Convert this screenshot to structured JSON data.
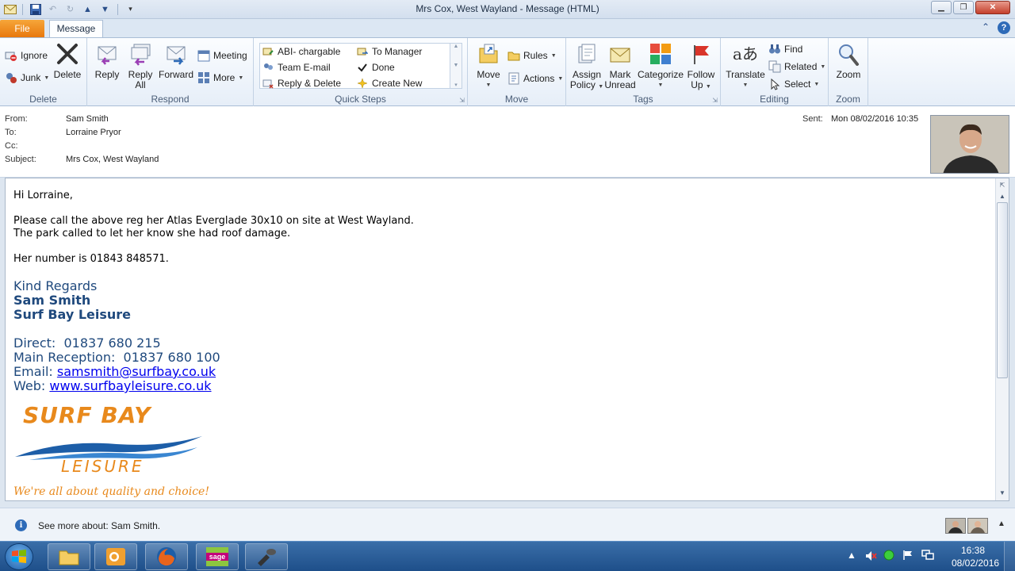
{
  "window": {
    "title": "Mrs Cox, West Wayland  -  Message (HTML)"
  },
  "tabs": {
    "file": "File",
    "message": "Message"
  },
  "ribbon": {
    "delete_group": {
      "label": "Delete",
      "ignore": "Ignore",
      "junk": "Junk",
      "delete": "Delete"
    },
    "respond_group": {
      "label": "Respond",
      "reply": "Reply",
      "reply_all_line1": "Reply",
      "reply_all_line2": "All",
      "forward": "Forward",
      "meeting": "Meeting",
      "more": "More"
    },
    "quick_steps_group": {
      "label": "Quick Steps",
      "items": [
        "ABI- chargable",
        "To Manager",
        "Team E-mail",
        "Done",
        "Reply & Delete",
        "Create New"
      ]
    },
    "move_group": {
      "label": "Move",
      "move": "Move",
      "rules": "Rules",
      "actions": "Actions"
    },
    "tags_group": {
      "label": "Tags",
      "assign_policy_line1": "Assign",
      "assign_policy_line2": "Policy",
      "mark_unread_line1": "Mark",
      "mark_unread_line2": "Unread",
      "categorize": "Categorize",
      "follow_up_line1": "Follow",
      "follow_up_line2": "Up"
    },
    "editing_group": {
      "label": "Editing",
      "translate": "Translate",
      "find": "Find",
      "related": "Related",
      "select": "Select"
    },
    "zoom_group": {
      "label": "Zoom",
      "zoom": "Zoom"
    }
  },
  "header": {
    "from_label": "From:",
    "from_value": "Sam Smith",
    "to_label": "To:",
    "to_value": "Lorraine Pryor",
    "cc_label": "Cc:",
    "cc_value": "",
    "subject_label": "Subject:",
    "subject_value": "Mrs Cox, West Wayland",
    "sent_label": "Sent:",
    "sent_value": "Mon 08/02/2016 10:35"
  },
  "body": {
    "greeting": "Hi Lorraine,",
    "line1": "Please call the above reg her Atlas Everglade 30x10 on site at West Wayland.",
    "line2": "The park called to let her know she had roof damage.",
    "line3": "Her number is 01843 848571.",
    "signature": {
      "regards": "Kind Regards",
      "name": "Sam Smith",
      "company": "Surf Bay Leisure",
      "direct_label": "Direct:",
      "direct_value": "01837 680 215",
      "reception_label": "Main Reception:",
      "reception_value": "01837 680 100",
      "email_label": "Email:",
      "email_value": "samsmith@surfbay.co.uk",
      "web_label": "Web:",
      "web_value": "www.surfbayleisure.co.uk"
    },
    "logo": {
      "line1": "SURF BAY",
      "line2": "LEISURE",
      "tagline": "We're all about quality and choice!",
      "orange": "#e8891c",
      "blue": "#1d5ea8"
    }
  },
  "people_pane": {
    "see_more": "See more about: Sam Smith."
  },
  "taskbar": {
    "apps": [
      "windows-explorer",
      "outlook",
      "firefox",
      "sage",
      "misc-app"
    ],
    "time": "16:38",
    "date": "08/02/2016"
  },
  "colors": {
    "file_tab": "#e8780c",
    "signature_blue": "#1f497d",
    "link": "#0000ee",
    "taskbar": "#1e4f8a"
  }
}
